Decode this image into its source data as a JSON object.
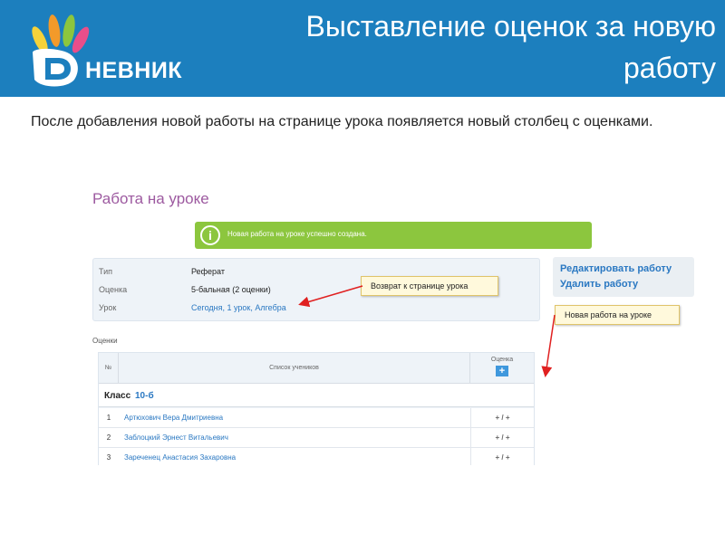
{
  "header": {
    "logo_text": "НЕВНИК",
    "slide_title": "Выставление оценок за новую работу"
  },
  "intro_text": "После добавления новой работы на странице урока появляется новый столбец с оценками.",
  "screenshot": {
    "page_heading": "Работа на уроке",
    "success_message": "Новая работа на уроке успешно создана.",
    "info": {
      "rows": [
        {
          "key": "Тип",
          "value": "Реферат"
        },
        {
          "key": "Оценка",
          "value": "5-бальная (2 оценки)"
        },
        {
          "key": "Урок",
          "value": "Сегодня, 1 урок, Алгебра"
        }
      ]
    },
    "actions": {
      "edit": "Редактировать работу",
      "delete": "Удалить работу"
    },
    "grades_label": "Оценки",
    "table": {
      "col_num": "№",
      "col_students": "Список учеников",
      "col_grade": "Оценка",
      "add_button": "+",
      "class_prefix": "Класс",
      "class_name": "10-б",
      "rows": [
        {
          "num": "1",
          "name": "Артюхович Вера Дмитриевна",
          "grade": "+ / +"
        },
        {
          "num": "2",
          "name": "Заблоцкий Эрнест Витальевич",
          "grade": "+ / +"
        },
        {
          "num": "3",
          "name": "Зареченец Анастасия Захаровна",
          "grade": "+ / +"
        }
      ]
    }
  },
  "callouts": {
    "back_to_lesson": "Возврат к странице урока",
    "new_work": "Новая работа на уроке"
  },
  "colors": {
    "header_blue": "#1c7fbe",
    "success_green": "#8cc63e",
    "link_blue": "#2a78c2",
    "heading_purple": "#9d5aa0",
    "arrow_red": "#e02020"
  }
}
